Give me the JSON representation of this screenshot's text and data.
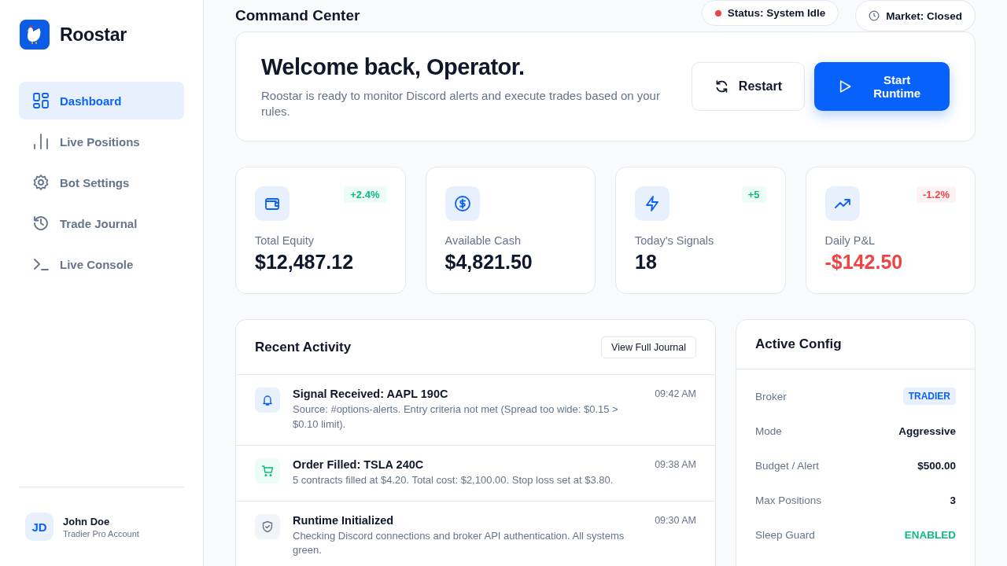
{
  "brand": {
    "name": "Roostar"
  },
  "nav": [
    {
      "label": "Dashboard",
      "selected": true
    },
    {
      "label": "Live Positions",
      "selected": false
    },
    {
      "label": "Bot Settings",
      "selected": false
    },
    {
      "label": "Trade Journal",
      "selected": false
    },
    {
      "label": "Live Console",
      "selected": false
    }
  ],
  "user": {
    "initials": "JD",
    "name": "John Doe",
    "plan": "Tradier Pro Account"
  },
  "page_title": "Command Center",
  "status_pills": [
    {
      "kind": "dot",
      "label": "Status: System Idle",
      "color": "#ef4444"
    },
    {
      "kind": "clock",
      "label": "Market: Closed"
    }
  ],
  "welcome": {
    "title": "Welcome back, Operator.",
    "text": "Roostar is ready to monitor Discord alerts and execute trades based on your rules.",
    "restart": "Restart",
    "start": "Start Runtime"
  },
  "stats": [
    {
      "kind": "gain",
      "label": "Total Equity",
      "value": "$12,487.12",
      "badge": "+2.4%"
    },
    {
      "kind": "plain",
      "label": "Available Cash",
      "value": "$4,821.50"
    },
    {
      "kind": "gain",
      "label": "Today's Signals",
      "value": "18",
      "badge": "+5"
    },
    {
      "kind": "loss",
      "label": "Daily P&L",
      "value": "-$142.50",
      "badge": "-1.2%"
    }
  ],
  "activity": {
    "title": "Recent Activity",
    "button": "View Full Journal",
    "items": [
      {
        "kind": "signal",
        "title": "Signal Received: AAPL 190C",
        "text": "Source: #options-alerts. Entry criteria not met (Spread too wide: $0.15 > $0.10 limit).",
        "time": "09:42 AM"
      },
      {
        "kind": "order",
        "title": "Order Filled: TSLA 240C",
        "text": "5 contracts filled at $4.20. Total cost: $2,100.00. Stop loss set at $3.80.",
        "time": "09:38 AM"
      },
      {
        "kind": "system",
        "title": "Runtime Initialized",
        "text": "Checking Discord connections and broker API authentication. All systems green.",
        "time": "09:30 AM"
      }
    ]
  },
  "config": {
    "title": "Active Config",
    "rows": [
      {
        "label": "Broker",
        "value": "TRADIER",
        "kind": "badge"
      },
      {
        "label": "Mode",
        "value": "Aggressive",
        "kind": "text"
      },
      {
        "label": "Budget / Alert",
        "value": "$500.00",
        "kind": "text"
      },
      {
        "label": "Max Positions",
        "value": "3",
        "kind": "text"
      },
      {
        "label": "Sleep Guard",
        "value": "ENABLED",
        "kind": "status"
      }
    ]
  }
}
